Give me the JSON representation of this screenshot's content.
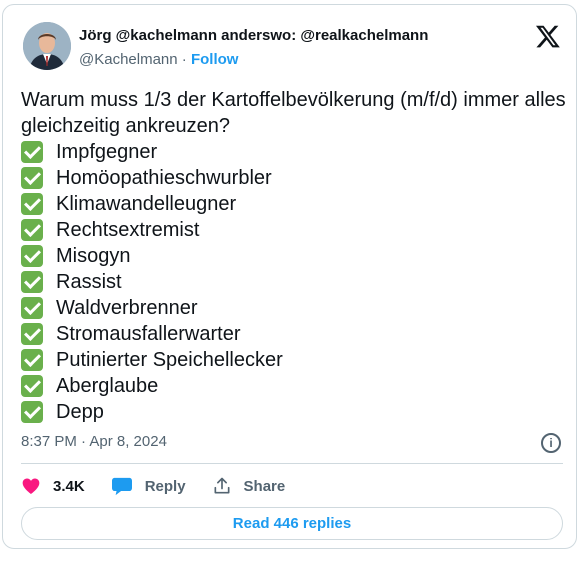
{
  "author": {
    "display_name": "Jörg @kachelmann anderswo: @realkachelmann",
    "handle": "@Kachelmann",
    "separator": "·",
    "follow_label": "Follow"
  },
  "tweet": {
    "intro": "Warum muss 1/3 der Kartoffelbevölkerung (m/f/d)  immer alles gleichzeitig ankreuzen?",
    "items": [
      "Impfgegner",
      "Homöopathieschwurbler",
      "Klimawandelleugner",
      "Rechtsextremist",
      "Misogyn",
      "Rassist",
      "Waldverbrenner",
      "Stromausfallerwarter",
      "Putinierter Speichellecker",
      "Aberglaube",
      "Depp"
    ],
    "timestamp": "8:37 PM · Apr 8, 2024"
  },
  "actions": {
    "likes": "3.4K",
    "reply_label": "Reply",
    "share_label": "Share"
  },
  "read_replies_label": "Read 446 replies",
  "icons": {
    "check": "check-mark-button-icon",
    "like": "heart-icon",
    "reply": "speech-bubble-icon",
    "share": "upload-share-icon",
    "info": "info-icon",
    "logo": "x-logo-icon"
  },
  "colors": {
    "accent": "#1d9bf0",
    "heart": "#f91880",
    "check_bg": "#6ab04c",
    "muted": "#536471"
  }
}
